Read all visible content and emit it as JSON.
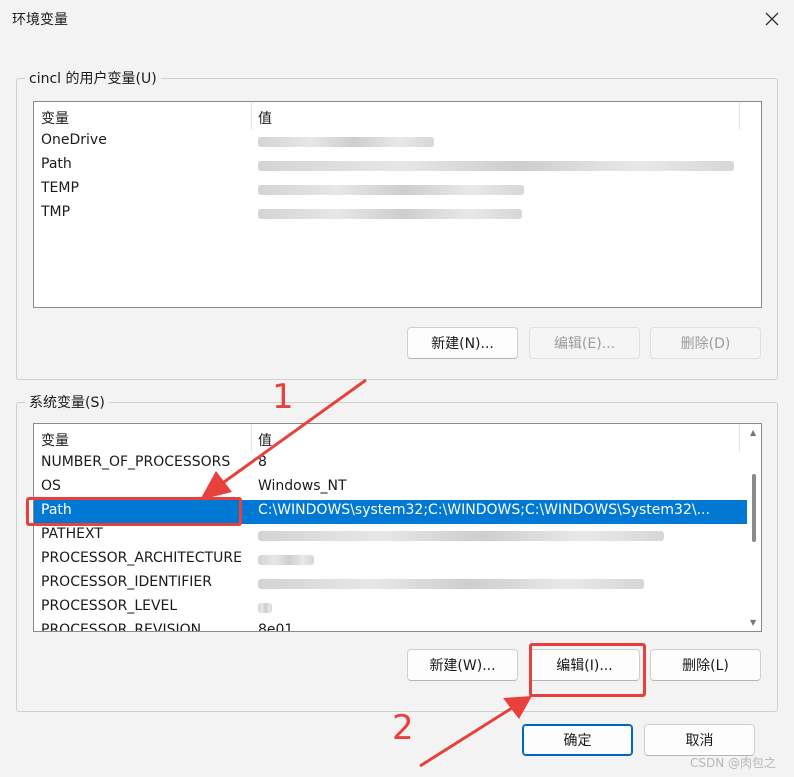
{
  "window": {
    "title": "环境变量"
  },
  "user_vars": {
    "group_label": "cincl 的用户变量(U)",
    "columns": [
      "变量",
      "值"
    ],
    "rows": [
      {
        "name": "OneDrive"
      },
      {
        "name": "Path"
      },
      {
        "name": "TEMP"
      },
      {
        "name": "TMP"
      }
    ],
    "buttons": {
      "new": "新建(N)...",
      "edit": "编辑(E)...",
      "delete": "删除(D)"
    }
  },
  "system_vars": {
    "group_label": "系统变量(S)",
    "columns": [
      "变量",
      "值"
    ],
    "rows": [
      {
        "name": "NUMBER_OF_PROCESSORS",
        "value": "8"
      },
      {
        "name": "OS",
        "value": "Windows_NT"
      },
      {
        "name": "Path",
        "value": "C:\\WINDOWS\\system32;C:\\WINDOWS;C:\\WINDOWS\\System32\\..."
      },
      {
        "name": "PATHEXT"
      },
      {
        "name": "PROCESSOR_ARCHITECTURE"
      },
      {
        "name": "PROCESSOR_IDENTIFIER"
      },
      {
        "name": "PROCESSOR_LEVEL"
      },
      {
        "name": "PROCESSOR_REVISION",
        "value": "8e01"
      }
    ],
    "selected_row": "Path",
    "buttons": {
      "new": "新建(W)...",
      "edit": "编辑(I)...",
      "delete": "删除(L)"
    }
  },
  "footer": {
    "ok": "确定",
    "cancel": "取消"
  },
  "annotations": {
    "step1": "1",
    "step2": "2",
    "color": "#e8413c"
  },
  "selection_color": "#0078d4",
  "watermark": "CSDN @肉包之",
  "icons": {
    "close": "close-icon"
  }
}
